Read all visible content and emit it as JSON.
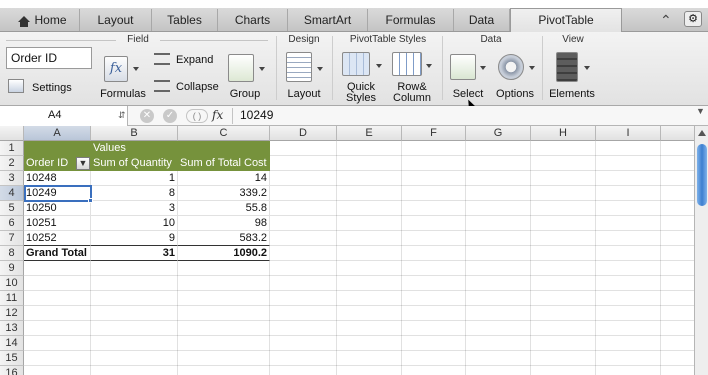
{
  "ribbon_tabs": [
    "Home",
    "Layout",
    "Tables",
    "Charts",
    "SmartArt",
    "Formulas",
    "Data",
    "PivotTable"
  ],
  "active_tab": "PivotTable",
  "ribbon": {
    "field": {
      "title": "Field",
      "field_name": "Order ID",
      "settings": "Settings",
      "formulas": "Formulas",
      "expand": "Expand",
      "collapse": "Collapse",
      "group": "Group"
    },
    "design": {
      "title": "Design",
      "layout": "Layout"
    },
    "styles": {
      "title": "PivotTable Styles",
      "quick_styles_1": "Quick",
      "quick_styles_2": "Styles",
      "rowcol_1": "Row&",
      "rowcol_2": "Column"
    },
    "data": {
      "title": "Data",
      "select": "Select",
      "options": "Options"
    },
    "view": {
      "title": "View",
      "elements": "Elements"
    }
  },
  "formula_bar": {
    "name_box": "A4",
    "fx": "fx",
    "value": "10249"
  },
  "columns": [
    "A",
    "B",
    "C",
    "D",
    "E",
    "F",
    "G",
    "H",
    "I"
  ],
  "rows": [
    "1",
    "2",
    "3",
    "4",
    "5",
    "6",
    "7",
    "8",
    "9",
    "10",
    "11",
    "12",
    "13",
    "14",
    "15",
    "16"
  ],
  "pivot": {
    "values_label": "Values",
    "headers": [
      "Order ID",
      "Sum of Quantity",
      "Sum of Total Cost"
    ],
    "data_rows": [
      [
        "10248",
        "1",
        "14"
      ],
      [
        "10249",
        "8",
        "339.2"
      ],
      [
        "10250",
        "3",
        "55.8"
      ],
      [
        "10251",
        "10",
        "98"
      ],
      [
        "10252",
        "9",
        "583.2"
      ]
    ],
    "total": [
      "Grand Total",
      "31",
      "1090.2"
    ]
  },
  "colors": {
    "pivot_header": "#76923c",
    "selection": "#3a6fbe"
  }
}
